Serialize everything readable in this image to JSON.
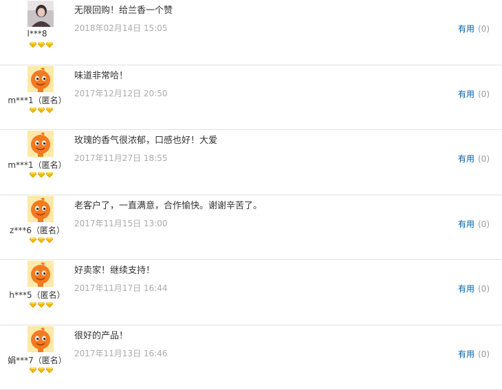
{
  "reviews": [
    {
      "user": "l***8",
      "avatar": "photo",
      "content": "无限回购！给兰香一个赞",
      "date": "2018年02月14日 15:05",
      "useful_label": "有用",
      "useful_count": "(0)"
    },
    {
      "user": "m***1（匿名）",
      "avatar": "mascot",
      "content": "味道非常哈！",
      "date": "2017年12月12日 20:50",
      "useful_label": "有用",
      "useful_count": "(0)"
    },
    {
      "user": "m***1（匿名）",
      "avatar": "mascot",
      "content": "玫瑰的香气很浓郁，口感也好！大爱",
      "date": "2017年11月27日 18:55",
      "useful_label": "有用",
      "useful_count": "(0)"
    },
    {
      "user": "z***6（匿名）",
      "avatar": "mascot",
      "content": "老客户了，一直满意，合作愉快。谢谢辛苦了。",
      "date": "2017年11月15日 13:00",
      "useful_label": "有用",
      "useful_count": "(0)"
    },
    {
      "user": "h***5（匿名）",
      "avatar": "mascot",
      "content": "好卖家！继续支持！",
      "date": "2017年11月17日 16:44",
      "useful_label": "有用",
      "useful_count": "(0)"
    },
    {
      "user": "娟***7（匿名）",
      "avatar": "mascot",
      "content": "很好的产品！",
      "date": "2017年11月13日 16:46",
      "useful_label": "有用",
      "useful_count": "(0)"
    }
  ],
  "rank_icon": "diamond-icon",
  "rank_count": 3,
  "colors": {
    "accent_link": "#005ea7",
    "date": "#aaaaaa",
    "mascot": "#f47a1f",
    "diamond": "#f5b800"
  }
}
